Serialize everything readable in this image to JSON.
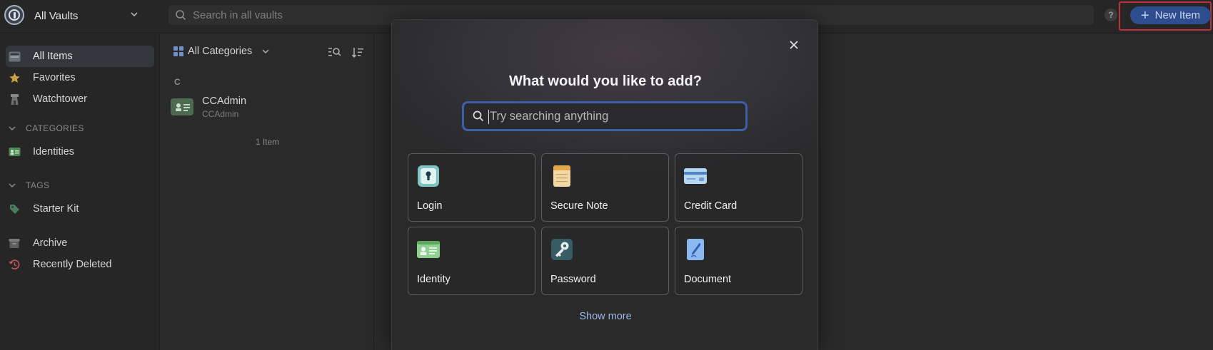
{
  "topbar": {
    "vault_name": "All Vaults",
    "search_placeholder": "Search in all vaults",
    "help_label": "?",
    "new_item_label": "New Item"
  },
  "sidebar": {
    "items": [
      {
        "label": "All Items",
        "icon": "all-items-icon"
      },
      {
        "label": "Favorites",
        "icon": "star-icon"
      },
      {
        "label": "Watchtower",
        "icon": "watchtower-icon"
      }
    ],
    "categories_heading": "CATEGORIES",
    "categories": [
      {
        "label": "Identities",
        "icon": "identity-icon"
      }
    ],
    "tags_heading": "TAGS",
    "tags": [
      {
        "label": "Starter Kit",
        "icon": "tag-icon"
      }
    ],
    "bottom": [
      {
        "label": "Archive",
        "icon": "archive-icon"
      },
      {
        "label": "Recently Deleted",
        "icon": "trash-icon"
      }
    ]
  },
  "list": {
    "category_filter": "All Categories",
    "section_letter": "C",
    "rows": [
      {
        "title": "CCAdmin",
        "subtitle": "CCAdmin"
      }
    ],
    "count_label": "1 Item"
  },
  "modal": {
    "title": "What would you like to add?",
    "search_placeholder": "Try searching anything",
    "tiles": [
      {
        "label": "Login",
        "icon": "login-lock-icon"
      },
      {
        "label": "Secure Note",
        "icon": "note-icon"
      },
      {
        "label": "Credit Card",
        "icon": "credit-card-icon"
      },
      {
        "label": "Identity",
        "icon": "identity-card-icon"
      },
      {
        "label": "Password",
        "icon": "key-icon"
      },
      {
        "label": "Document",
        "icon": "document-icon"
      }
    ],
    "show_more_label": "Show more"
  },
  "colors": {
    "accent_blue": "#2e4d8f",
    "highlight_red": "#c0303a",
    "link_blue": "#9fb7e8"
  }
}
